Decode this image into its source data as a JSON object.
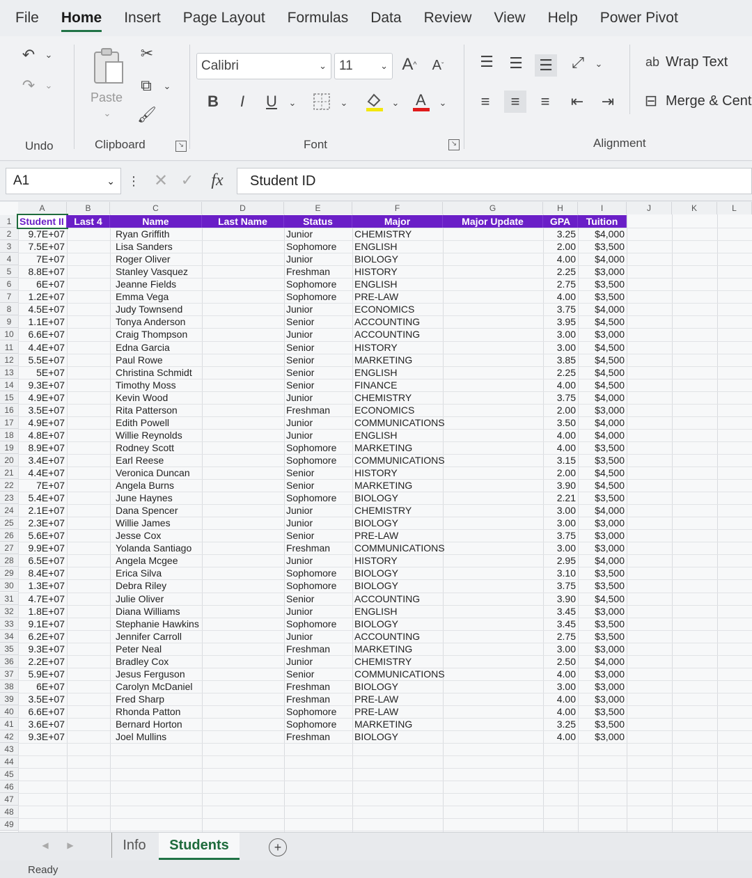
{
  "menu": {
    "tabs": [
      "File",
      "Home",
      "Insert",
      "Page Layout",
      "Formulas",
      "Data",
      "Review",
      "View",
      "Help",
      "Power Pivot"
    ],
    "active": "Home"
  },
  "ribbon": {
    "undo_label": "Undo",
    "clipboard_label": "Clipboard",
    "paste_label": "Paste",
    "font_label": "Font",
    "alignment_label": "Alignment",
    "font_name": "Calibri",
    "font_size": "11",
    "bold": "B",
    "italic": "I",
    "underline": "U",
    "wrap_text": "Wrap Text",
    "merge_center": "Merge & Cent"
  },
  "formula_bar": {
    "name_box": "A1",
    "content": "Student ID"
  },
  "columns": [
    "A",
    "B",
    "C",
    "D",
    "E",
    "F",
    "G",
    "H",
    "I",
    "J",
    "K",
    "L"
  ],
  "headers": [
    "Student II",
    "Last 4",
    "Name",
    "Last Name",
    "Status",
    "Major",
    "Major Update",
    "GPA",
    "Tuition"
  ],
  "rows": [
    [
      "9.7E+07",
      "Ryan Griffith",
      "Junior",
      "CHEMISTRY",
      "3.25",
      "$4,000"
    ],
    [
      "7.5E+07",
      "Lisa Sanders",
      "Sophomore",
      "ENGLISH",
      "2.00",
      "$3,500"
    ],
    [
      "7E+07",
      "Roger Oliver",
      "Junior",
      "BIOLOGY",
      "4.00",
      "$4,000"
    ],
    [
      "8.8E+07",
      "Stanley Vasquez",
      "Freshman",
      "HISTORY",
      "2.25",
      "$3,000"
    ],
    [
      "6E+07",
      "Jeanne Fields",
      "Sophomore",
      "ENGLISH",
      "2.75",
      "$3,500"
    ],
    [
      "1.2E+07",
      "Emma Vega",
      "Sophomore",
      "PRE-LAW",
      "4.00",
      "$3,500"
    ],
    [
      "4.5E+07",
      "Judy Townsend",
      "Junior",
      "ECONOMICS",
      "3.75",
      "$4,000"
    ],
    [
      "1.1E+07",
      "Tonya Anderson",
      "Senior",
      "ACCOUNTING",
      "3.95",
      "$4,500"
    ],
    [
      "6.6E+07",
      "Craig Thompson",
      "Junior",
      "ACCOUNTING",
      "3.00",
      "$3,000"
    ],
    [
      "4.4E+07",
      "Edna Garcia",
      "Senior",
      "HISTORY",
      "3.00",
      "$4,500"
    ],
    [
      "5.5E+07",
      "Paul Rowe",
      "Senior",
      "MARKETING",
      "3.85",
      "$4,500"
    ],
    [
      "5E+07",
      "Christina Schmidt",
      "Senior",
      "ENGLISH",
      "2.25",
      "$4,500"
    ],
    [
      "9.3E+07",
      "Timothy Moss",
      "Senior",
      "FINANCE",
      "4.00",
      "$4,500"
    ],
    [
      "4.9E+07",
      "Kevin Wood",
      "Junior",
      "CHEMISTRY",
      "3.75",
      "$4,000"
    ],
    [
      "3.5E+07",
      "Rita Patterson",
      "Freshman",
      "ECONOMICS",
      "2.00",
      "$3,000"
    ],
    [
      "4.9E+07",
      "Edith Powell",
      "Junior",
      "COMMUNICATIONS",
      "3.50",
      "$4,000"
    ],
    [
      "4.8E+07",
      "Willie Reynolds",
      "Junior",
      "ENGLISH",
      "4.00",
      "$4,000"
    ],
    [
      "8.9E+07",
      "Rodney Scott",
      "Sophomore",
      "MARKETING",
      "4.00",
      "$3,500"
    ],
    [
      "3.4E+07",
      "Earl Reese",
      "Sophomore",
      "COMMUNICATIONS",
      "3.15",
      "$3,500"
    ],
    [
      "4.4E+07",
      "Veronica Duncan",
      "Senior",
      "HISTORY",
      "2.00",
      "$4,500"
    ],
    [
      "7E+07",
      "Angela Burns",
      "Senior",
      "MARKETING",
      "3.90",
      "$4,500"
    ],
    [
      "5.4E+07",
      "June Haynes",
      "Sophomore",
      "BIOLOGY",
      "2.21",
      "$3,500"
    ],
    [
      "2.1E+07",
      "Dana Spencer",
      "Junior",
      "CHEMISTRY",
      "3.00",
      "$4,000"
    ],
    [
      "2.3E+07",
      "Willie James",
      "Junior",
      "BIOLOGY",
      "3.00",
      "$3,000"
    ],
    [
      "5.6E+07",
      "Jesse Cox",
      "Senior",
      "PRE-LAW",
      "3.75",
      "$3,000"
    ],
    [
      "9.9E+07",
      "Yolanda Santiago",
      "Freshman",
      "COMMUNICATIONS",
      "3.00",
      "$3,000"
    ],
    [
      "6.5E+07",
      "Angela Mcgee",
      "Junior",
      "HISTORY",
      "2.95",
      "$4,000"
    ],
    [
      "8.4E+07",
      "Erica Silva",
      "Sophomore",
      "BIOLOGY",
      "3.10",
      "$3,500"
    ],
    [
      "1.3E+07",
      "Debra Riley",
      "Sophomore",
      "BIOLOGY",
      "3.75",
      "$3,500"
    ],
    [
      "4.7E+07",
      "Julie Oliver",
      "Senior",
      "ACCOUNTING",
      "3.90",
      "$4,500"
    ],
    [
      "1.8E+07",
      "Diana Williams",
      "Junior",
      "ENGLISH",
      "3.45",
      "$3,000"
    ],
    [
      "9.1E+07",
      "Stephanie Hawkins",
      "Sophomore",
      "BIOLOGY",
      "3.45",
      "$3,500"
    ],
    [
      "6.2E+07",
      "Jennifer Carroll",
      "Junior",
      "ACCOUNTING",
      "2.75",
      "$3,500"
    ],
    [
      "9.3E+07",
      "Peter Neal",
      "Freshman",
      "MARKETING",
      "3.00",
      "$3,000"
    ],
    [
      "2.2E+07",
      "Bradley Cox",
      "Junior",
      "CHEMISTRY",
      "2.50",
      "$4,000"
    ],
    [
      "5.9E+07",
      "Jesus Ferguson",
      "Senior",
      "COMMUNICATIONS",
      "4.00",
      "$3,000"
    ],
    [
      "6E+07",
      "Carolyn McDaniel",
      "Freshman",
      "BIOLOGY",
      "3.00",
      "$3,000"
    ],
    [
      "3.5E+07",
      "Fred Sharp",
      "Freshman",
      "PRE-LAW",
      "4.00",
      "$3,000"
    ],
    [
      "6.6E+07",
      "Rhonda Patton",
      "Sophomore",
      "PRE-LAW",
      "4.00",
      "$3,500"
    ],
    [
      "3.6E+07",
      "Bernard Horton",
      "Sophomore",
      "MARKETING",
      "3.25",
      "$3,500"
    ],
    [
      "9.3E+07",
      "Joel Mullins",
      "Freshman",
      "BIOLOGY",
      "4.00",
      "$3,000"
    ]
  ],
  "row_numbers": [
    "1",
    "2",
    "3",
    "4",
    "5",
    "6",
    "7",
    "8",
    "9",
    "10",
    "11",
    "12",
    "13",
    "14",
    "15",
    "16",
    "17",
    "18",
    "19",
    "20",
    "21",
    "22",
    "23",
    "24",
    "25",
    "26",
    "27",
    "28",
    "29",
    "30",
    "31",
    "32",
    "33",
    "34",
    "35",
    "36",
    "37",
    "38",
    "39",
    "40",
    "41",
    "42",
    "43",
    "44",
    "45",
    "46",
    "47",
    "48",
    "49"
  ],
  "sheet_tabs": [
    "Info",
    "Students"
  ],
  "active_sheet": "Students",
  "add_sheet_icon": "+",
  "status": "Ready",
  "colors": {
    "header_fill": "#6a1fc7",
    "accent": "#217346"
  }
}
